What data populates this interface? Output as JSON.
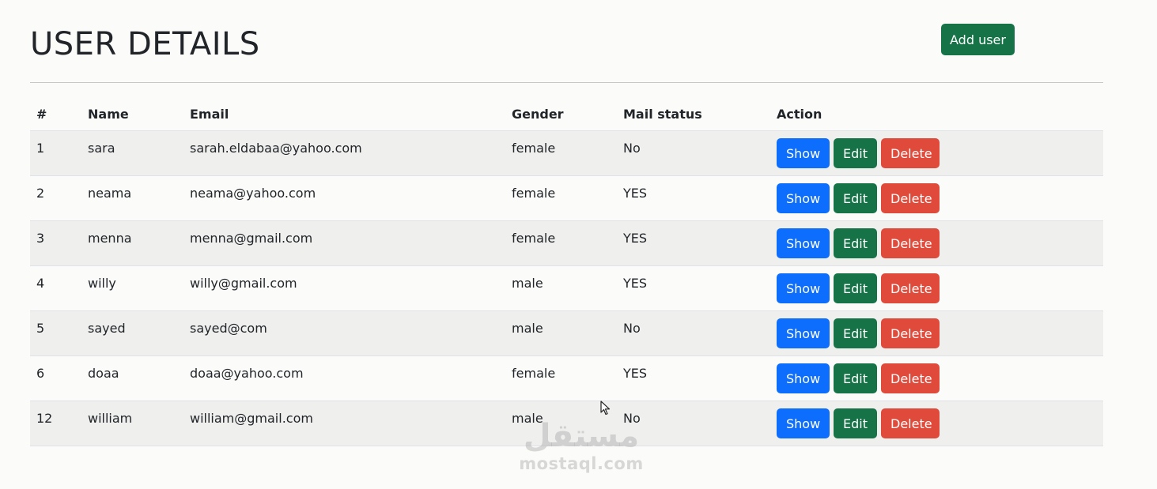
{
  "header": {
    "title": "USER DETAILS",
    "add_user_label": "Add user"
  },
  "table": {
    "columns": [
      "#",
      "Name",
      "Email",
      "Gender",
      "Mail status",
      "Action"
    ],
    "rows": [
      {
        "id": "1",
        "name": "sara",
        "email": "sarah.eldabaa@yahoo.com",
        "gender": "female",
        "mail_status": "No"
      },
      {
        "id": "2",
        "name": "neama",
        "email": "neama@yahoo.com",
        "gender": "female",
        "mail_status": "YES"
      },
      {
        "id": "3",
        "name": "menna",
        "email": "menna@gmail.com",
        "gender": "female",
        "mail_status": "YES"
      },
      {
        "id": "4",
        "name": "willy",
        "email": "willy@gmail.com",
        "gender": "male",
        "mail_status": "YES"
      },
      {
        "id": "5",
        "name": "sayed",
        "email": "sayed@com",
        "gender": "male",
        "mail_status": "No"
      },
      {
        "id": "6",
        "name": "doaa",
        "email": "doaa@yahoo.com",
        "gender": "female",
        "mail_status": "YES"
      },
      {
        "id": "12",
        "name": "william",
        "email": "william@gmail.com",
        "gender": "male",
        "mail_status": "No"
      }
    ],
    "actions": {
      "show": "Show",
      "edit": "Edit",
      "delete": "Delete"
    }
  },
  "watermark": {
    "arabic": "مستقل",
    "latin": "mostaql.com"
  },
  "colors": {
    "primary": "#0d6efd",
    "success": "#157347",
    "danger": "#e04a3b",
    "stripe": "#efefee",
    "background": "#fbfbfa"
  },
  "icons": {
    "cursor": "mouse-pointer-icon"
  }
}
